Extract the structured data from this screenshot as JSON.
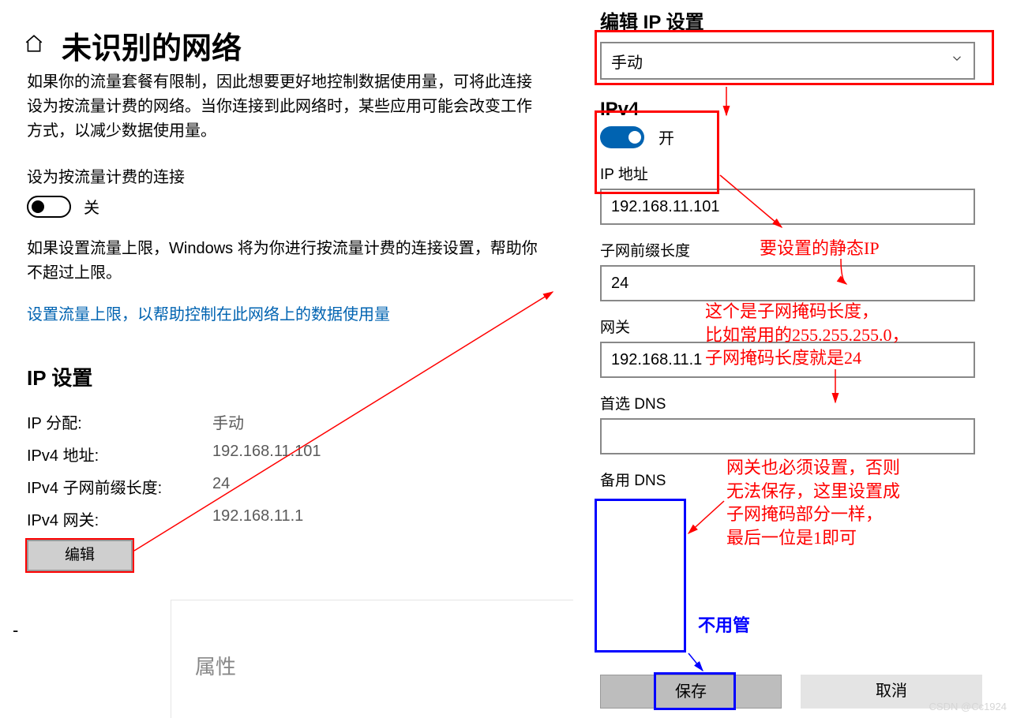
{
  "left": {
    "title": "未识别的网络",
    "desc_top_cut": "如果你的流量套餐有限制，因此想要更好地控制数据使用量，可将此连接设为按流量计费的网络。当你连接到此网络时，某些应用可能会改变工作方式，以减少数据使用量。",
    "metered_label": "设为按流量计费的连接",
    "toggle_off_label": "关",
    "limit_help": "如果设置流量上限，Windows 将为你进行按流量计费的连接设置，帮助你不超过上限。",
    "set_limit_link": "设置流量上限，以帮助控制在此网络上的数据使用量",
    "ip_section": "IP 设置",
    "rows": {
      "alloc_k": "IP 分配:",
      "alloc_v": "手动",
      "addr_k": "IPv4 地址:",
      "addr_v": "192.168.11.101",
      "prefix_k": "IPv4 子网前缀长度:",
      "prefix_v": "24",
      "gw_k": "IPv4 网关:",
      "gw_v": "192.168.11.1"
    },
    "edit_btn": "编辑",
    "properties_title": "属性"
  },
  "right": {
    "title": "编辑 IP 设置",
    "mode_value": "手动",
    "ipv4_heading": "IPv4",
    "ipv4_toggle_label": "开",
    "ip_label": "IP 地址",
    "ip_value": "192.168.11.101",
    "prefix_label": "子网前缀长度",
    "prefix_value": "24",
    "gw_label": "网关",
    "gw_value": "192.168.11.1",
    "dns1_label": "首选 DNS",
    "dns1_value": "",
    "dns2_label": "备用 DNS",
    "dns2_value": "",
    "save_btn": "保存",
    "cancel_btn": "取消"
  },
  "anno": {
    "static_ip": "要设置的静态IP",
    "prefix_note": "这个是子网掩码长度，\n比如常用的255.255.255.0，\n子网掩码长度就是24",
    "gw_note": "网关也必须设置，否则\n无法保存，这里设置成\n子网掩码部分一样，\n最后一位是1即可",
    "dns_ignore": "不用管"
  },
  "watermark": "CSDN @Cc1924"
}
